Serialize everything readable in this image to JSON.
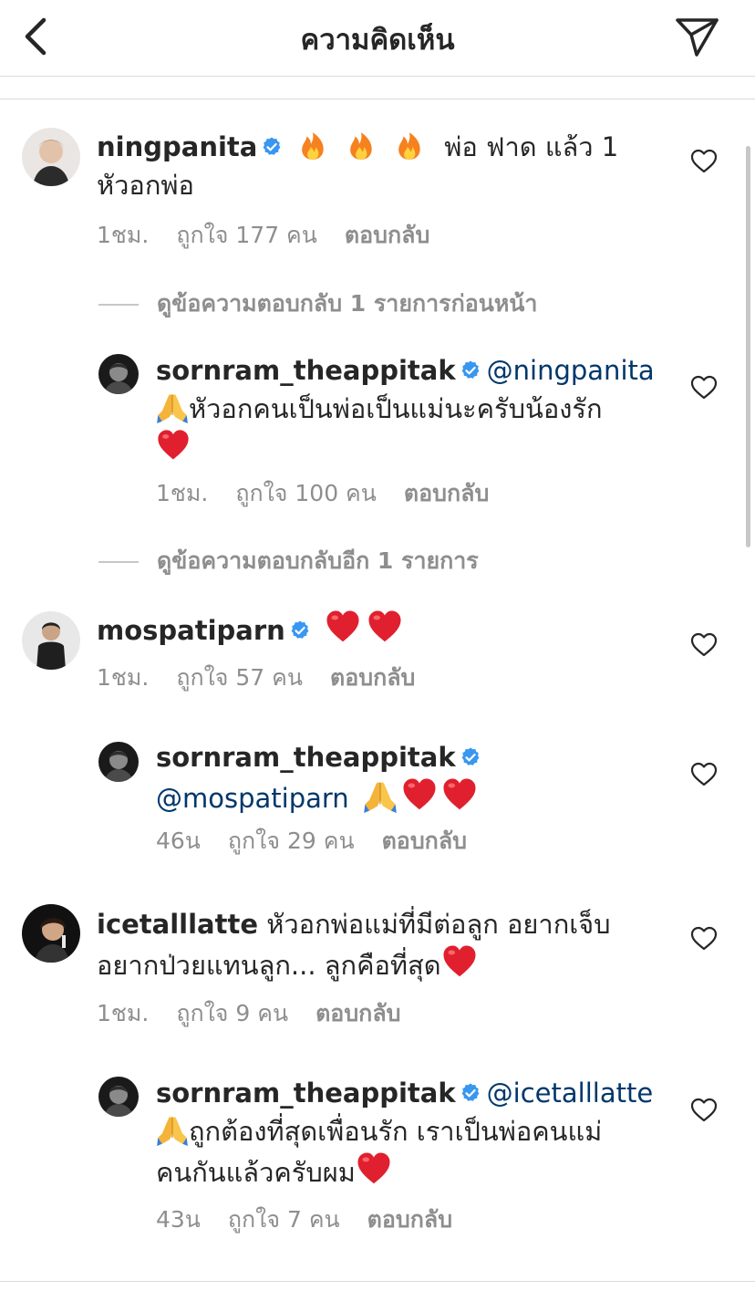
{
  "header": {
    "title": "ความคิดเห็น"
  },
  "icons": {
    "back": "chevron-left-icon",
    "send": "paper-plane-icon",
    "like": "heart-outline-icon",
    "verified": "verified-badge-icon"
  },
  "colors": {
    "verified": "#3897f0",
    "mention": "#00376b",
    "meta": "#8e8e8e",
    "heart_emoji": "#e0202e"
  },
  "comments": [
    {
      "username": "ningpanita",
      "text_after_emoji": "พ่อ ฟาด แล้ว 1",
      "text_line2": "หัวอกพ่อ",
      "emojis": [
        "fire",
        "fire",
        "fire"
      ],
      "time": "1ชม.",
      "likes": "ถูกใจ 177 คน",
      "reply": "ตอบกลับ"
    },
    {
      "username": "sornram_theappitak",
      "mention": "@ningpanita",
      "text_line2": "หัวอกคนเป็นพ่อเป็นแม่นะครับน้องรัก",
      "time": "1ชม.",
      "likes": "ถูกใจ 100 คน",
      "reply": "ตอบกลับ"
    },
    {
      "username": "mospatiparn",
      "time": "1ชม.",
      "likes": "ถูกใจ 57 คน",
      "reply": "ตอบกลับ"
    },
    {
      "username": "sornram_theappitak",
      "mention": "@mospatiparn",
      "time": "46น",
      "likes": "ถูกใจ 29 คน",
      "reply": "ตอบกลับ"
    },
    {
      "username": "icetalllatte",
      "text_line1": "หัวอกพ่อแม่ที่มีต่อลูก อยากเจ็บ",
      "text_line2": "อยากป่วยแทนลูก... ลูกคือที่สุด",
      "time": "1ชม.",
      "likes": "ถูกใจ 9 คน",
      "reply": "ตอบกลับ"
    },
    {
      "username": "sornram_theappitak",
      "mention": "@icetalllatte",
      "text_line2": "ถูกต้องที่สุดเพื่อนรัก เราเป็นพ่อคนแม่",
      "text_line3": "คนกันแล้วครับผม",
      "time": "43น",
      "likes": "ถูกใจ 7 คน",
      "reply": "ตอบกลับ"
    }
  ],
  "view_replies": [
    "ดูข้อความตอบกลับ 1 รายการก่อนหน้า",
    "ดูข้อความตอบกลับอีก 1 รายการ"
  ]
}
